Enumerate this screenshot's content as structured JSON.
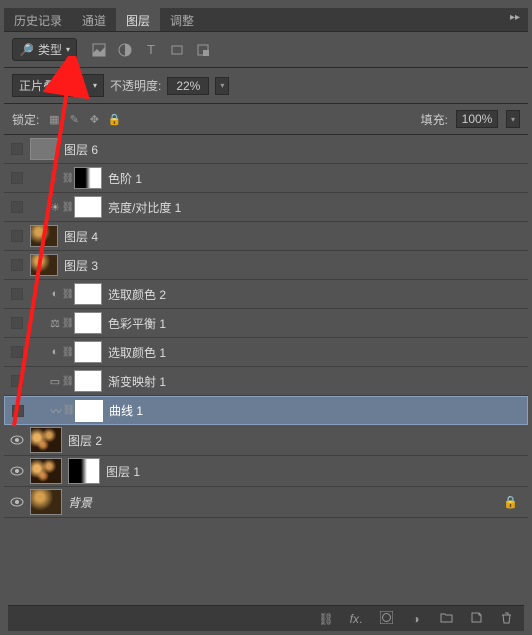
{
  "tabs": {
    "history": "历史记录",
    "channels": "通道",
    "layers": "图层",
    "adjustments": "调整"
  },
  "filter": {
    "label": "类型"
  },
  "blend": {
    "mode": "正片叠底",
    "opacity_label": "不透明度:",
    "opacity": "22%",
    "fill_label": "填充:",
    "fill": "100%"
  },
  "lock": {
    "label": "锁定:"
  },
  "layers": [
    {
      "name": "图层 6"
    },
    {
      "name": "色阶 1"
    },
    {
      "name": "亮度/对比度 1"
    },
    {
      "name": "图层 4"
    },
    {
      "name": "图层 3"
    },
    {
      "name": "选取颜色 2"
    },
    {
      "name": "色彩平衡 1"
    },
    {
      "name": "选取颜色 1"
    },
    {
      "name": "渐变映射 1"
    },
    {
      "name": "曲线 1"
    },
    {
      "name": "图层 2"
    },
    {
      "name": "图层 1"
    },
    {
      "name": "背景"
    }
  ]
}
